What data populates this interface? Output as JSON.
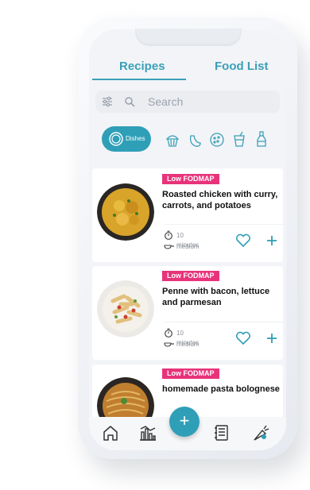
{
  "tabs": [
    {
      "label": "Recipes",
      "active": true
    },
    {
      "label": "Food List",
      "active": false
    }
  ],
  "search": {
    "placeholder": "Search"
  },
  "categories": {
    "active_label": "Dishes",
    "icons": [
      "plate-icon",
      "muffin-icon",
      "fruit-icon",
      "cookie-icon",
      "drink-icon",
      "sauce-icon"
    ]
  },
  "recipes": [
    {
      "badge": "Low FODMAP",
      "title": "Roasted chicken with curry, carrots, and potatoes",
      "time": "10 minutes",
      "difficulty": "medium"
    },
    {
      "badge": "Low FODMAP",
      "title": "Penne with bacon, lettuce and parmesan",
      "time": "10 minutes",
      "difficulty": "medium"
    },
    {
      "badge": "Low FODMAP",
      "title": "homemade pasta bolognese"
    }
  ],
  "nav": {
    "items": [
      "home-icon",
      "chart-icon",
      "add-icon",
      "journal-icon",
      "carrot-icon"
    ],
    "fab_symbol": "+"
  },
  "colors": {
    "accent": "#2f9fb8",
    "badge": "#e8337a"
  }
}
